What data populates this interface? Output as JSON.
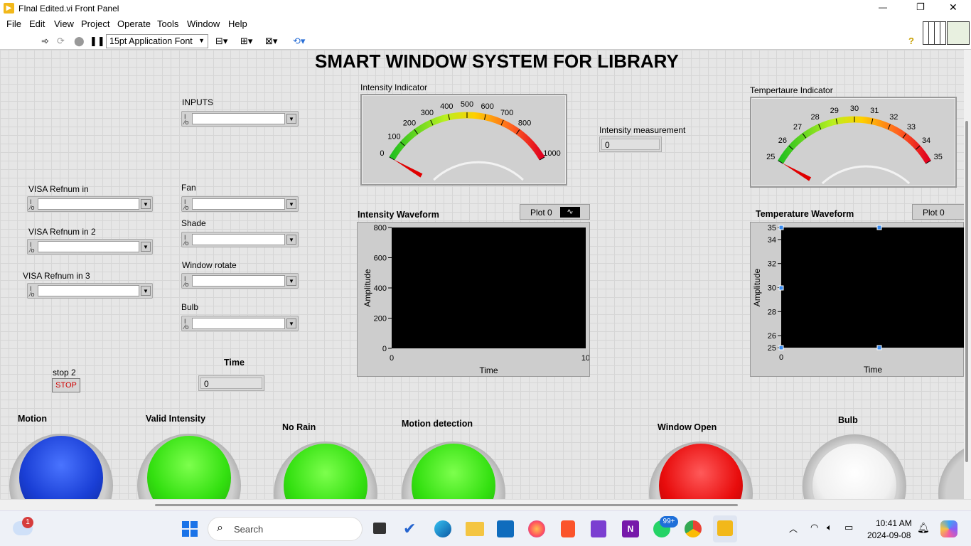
{
  "window": {
    "title": "FInal Edited.vi Front Panel",
    "minimize": "—",
    "restore": "❐",
    "close": "✕"
  },
  "menu": [
    "File",
    "Edit",
    "View",
    "Project",
    "Operate",
    "Tools",
    "Window",
    "Help"
  ],
  "toolbar": {
    "font_select": "15pt Application Font",
    "help": "?"
  },
  "panel_title": "SMART WINDOW SYSTEM FOR LIBRARY",
  "inputs_label": "INPUTS",
  "controls": {
    "visa1": "VISA Refnum in",
    "visa2": "VISA Refnum in 2",
    "visa3": "VISA Refnum in 3",
    "fan": "Fan",
    "shade": "Shade",
    "window_rotate": "Window rotate",
    "bulb": "Bulb",
    "stop_label": "stop 2",
    "stop_button": "STOP",
    "time_label": "Time",
    "time_value": "0",
    "io_glyph": "I/O"
  },
  "intensity_gauge": {
    "label": "Intensity Indicator",
    "min": 0,
    "max": 1000,
    "value": 0,
    "ticks": [
      "0",
      "100",
      "200",
      "300",
      "400",
      "500",
      "600",
      "700",
      "800",
      "1000"
    ]
  },
  "intensity_measurement": {
    "label": "Intensity measurement",
    "value": "0"
  },
  "temperature_gauge": {
    "label": "Tempertaure Indicator",
    "min": 25,
    "max": 35,
    "value": 25,
    "ticks": [
      "25",
      "26",
      "27",
      "28",
      "29",
      "30",
      "31",
      "32",
      "33",
      "34",
      "35"
    ]
  },
  "intensity_chart": {
    "title": "Intensity Waveform",
    "legend": "Plot 0",
    "ylabel": "Amplitude",
    "xlabel": "Time",
    "yticks": [
      "800",
      "600",
      "400",
      "200",
      "0"
    ],
    "xticks": [
      "0",
      "10"
    ]
  },
  "temperature_chart": {
    "title": "Temperature Waveform",
    "legend": "Plot 0",
    "ylabel": "Amplitude",
    "xlabel": "Time",
    "yticks": [
      "35",
      "34",
      "32",
      "30",
      "28",
      "26",
      "25"
    ],
    "xticks": [
      "0"
    ]
  },
  "leds": {
    "motion": "Motion",
    "valid_intensity": "Valid Intensity",
    "no_rain": "No Rain",
    "motion_detection": "Motion detection",
    "window_open": "Window Open",
    "bulb": "Bulb"
  },
  "colors": {
    "led_blue": "#1a3fd6",
    "led_green": "#33e010",
    "led_red": "#e80c0c",
    "led_white": "#f4f4f4",
    "stop_red": "#d00000"
  },
  "taskbar": {
    "search": "Search",
    "time": "10:41 AM",
    "date": "2024-09-08",
    "weather_badge": "1",
    "whatsapp_badge": "99+"
  }
}
